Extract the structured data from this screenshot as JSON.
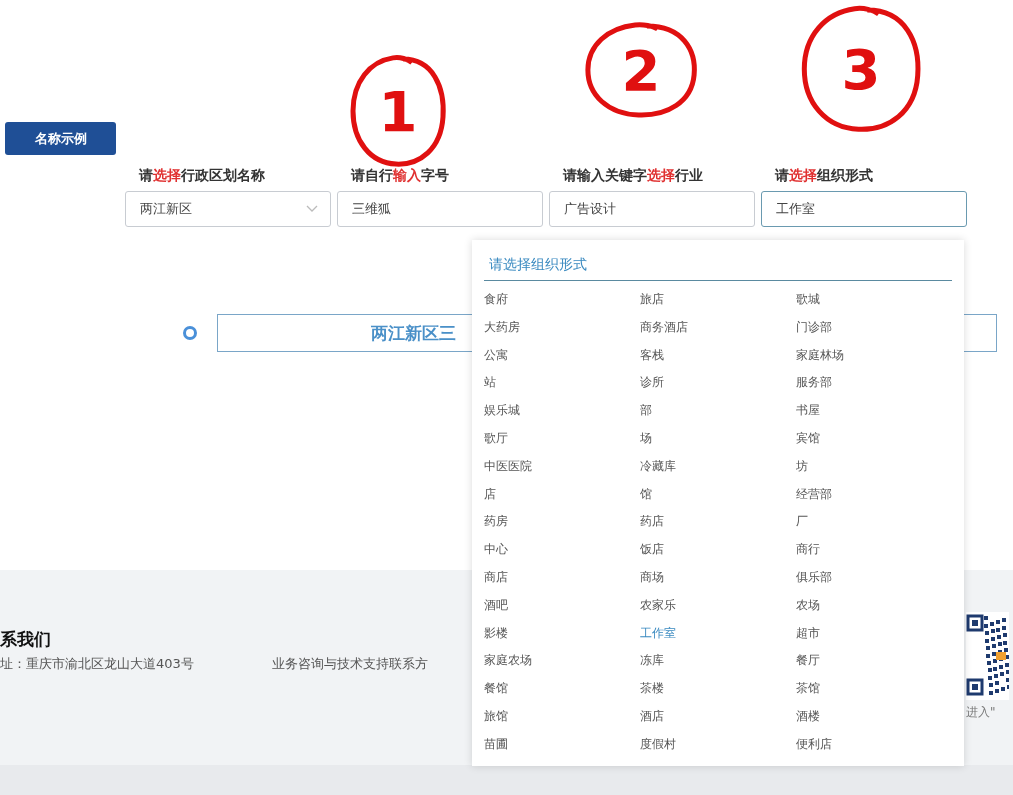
{
  "annotations": [
    {
      "label": "1"
    },
    {
      "label": "2"
    },
    {
      "label": "3"
    }
  ],
  "example_button": "名称示例",
  "fields": [
    {
      "kind": "select",
      "label": [
        {
          "text": "请",
          "highlight": false
        },
        {
          "text": "选择",
          "highlight": true
        },
        {
          "text": "行政区划名称",
          "highlight": false
        }
      ],
      "value": "两江新区",
      "focused": false
    },
    {
      "kind": "input",
      "label": [
        {
          "text": "请自行",
          "highlight": false
        },
        {
          "text": "输入",
          "highlight": true
        },
        {
          "text": "字号",
          "highlight": false
        }
      ],
      "value": "三维狐",
      "focused": false
    },
    {
      "kind": "input",
      "label": [
        {
          "text": "请输入关键字",
          "highlight": false
        },
        {
          "text": "选择",
          "highlight": true
        },
        {
          "text": "行业",
          "highlight": false
        }
      ],
      "value": "广告设计",
      "focused": false
    },
    {
      "kind": "input",
      "label": [
        {
          "text": "请",
          "highlight": false
        },
        {
          "text": "选择",
          "highlight": true
        },
        {
          "text": "组织形式",
          "highlight": false
        }
      ],
      "value": "工作室",
      "focused": true
    }
  ],
  "result": {
    "text": "两江新区三"
  },
  "dropdown": {
    "title": "请选择组织形式",
    "options": [
      {
        "label": "食府",
        "selected": false
      },
      {
        "label": "旅店",
        "selected": false
      },
      {
        "label": "歌城",
        "selected": false
      },
      {
        "label": "大药房",
        "selected": false
      },
      {
        "label": "商务酒店",
        "selected": false
      },
      {
        "label": "门诊部",
        "selected": false
      },
      {
        "label": "公寓",
        "selected": false
      },
      {
        "label": "客栈",
        "selected": false
      },
      {
        "label": "家庭林场",
        "selected": false
      },
      {
        "label": "站",
        "selected": false
      },
      {
        "label": "诊所",
        "selected": false
      },
      {
        "label": "服务部",
        "selected": false
      },
      {
        "label": "娱乐城",
        "selected": false
      },
      {
        "label": "部",
        "selected": false
      },
      {
        "label": "书屋",
        "selected": false
      },
      {
        "label": "歌厅",
        "selected": false
      },
      {
        "label": "场",
        "selected": false
      },
      {
        "label": "宾馆",
        "selected": false
      },
      {
        "label": "中医医院",
        "selected": false
      },
      {
        "label": "冷藏库",
        "selected": false
      },
      {
        "label": "坊",
        "selected": false
      },
      {
        "label": "店",
        "selected": false
      },
      {
        "label": "馆",
        "selected": false
      },
      {
        "label": "经营部",
        "selected": false
      },
      {
        "label": "药房",
        "selected": false
      },
      {
        "label": "药店",
        "selected": false
      },
      {
        "label": "厂",
        "selected": false
      },
      {
        "label": "中心",
        "selected": false
      },
      {
        "label": "饭店",
        "selected": false
      },
      {
        "label": "商行",
        "selected": false
      },
      {
        "label": "商店",
        "selected": false
      },
      {
        "label": "商场",
        "selected": false
      },
      {
        "label": "俱乐部",
        "selected": false
      },
      {
        "label": "酒吧",
        "selected": false
      },
      {
        "label": "农家乐",
        "selected": false
      },
      {
        "label": "农场",
        "selected": false
      },
      {
        "label": "影楼",
        "selected": false
      },
      {
        "label": "工作室",
        "selected": true
      },
      {
        "label": "超市",
        "selected": false
      },
      {
        "label": "家庭农场",
        "selected": false
      },
      {
        "label": "冻库",
        "selected": false
      },
      {
        "label": "餐厅",
        "selected": false
      },
      {
        "label": "餐馆",
        "selected": false
      },
      {
        "label": "茶楼",
        "selected": false
      },
      {
        "label": "茶馆",
        "selected": false
      },
      {
        "label": "旅馆",
        "selected": false
      },
      {
        "label": "酒店",
        "selected": false
      },
      {
        "label": "酒楼",
        "selected": false
      },
      {
        "label": "苗圃",
        "selected": false
      },
      {
        "label": "度假村",
        "selected": false
      },
      {
        "label": "便利店",
        "selected": false
      }
    ]
  },
  "footer": {
    "heading": "系我们",
    "address": "址：重庆市渝北区龙山大道403号",
    "contact": "业务咨询与技术支持联系方",
    "qr_caption": "进入\""
  }
}
